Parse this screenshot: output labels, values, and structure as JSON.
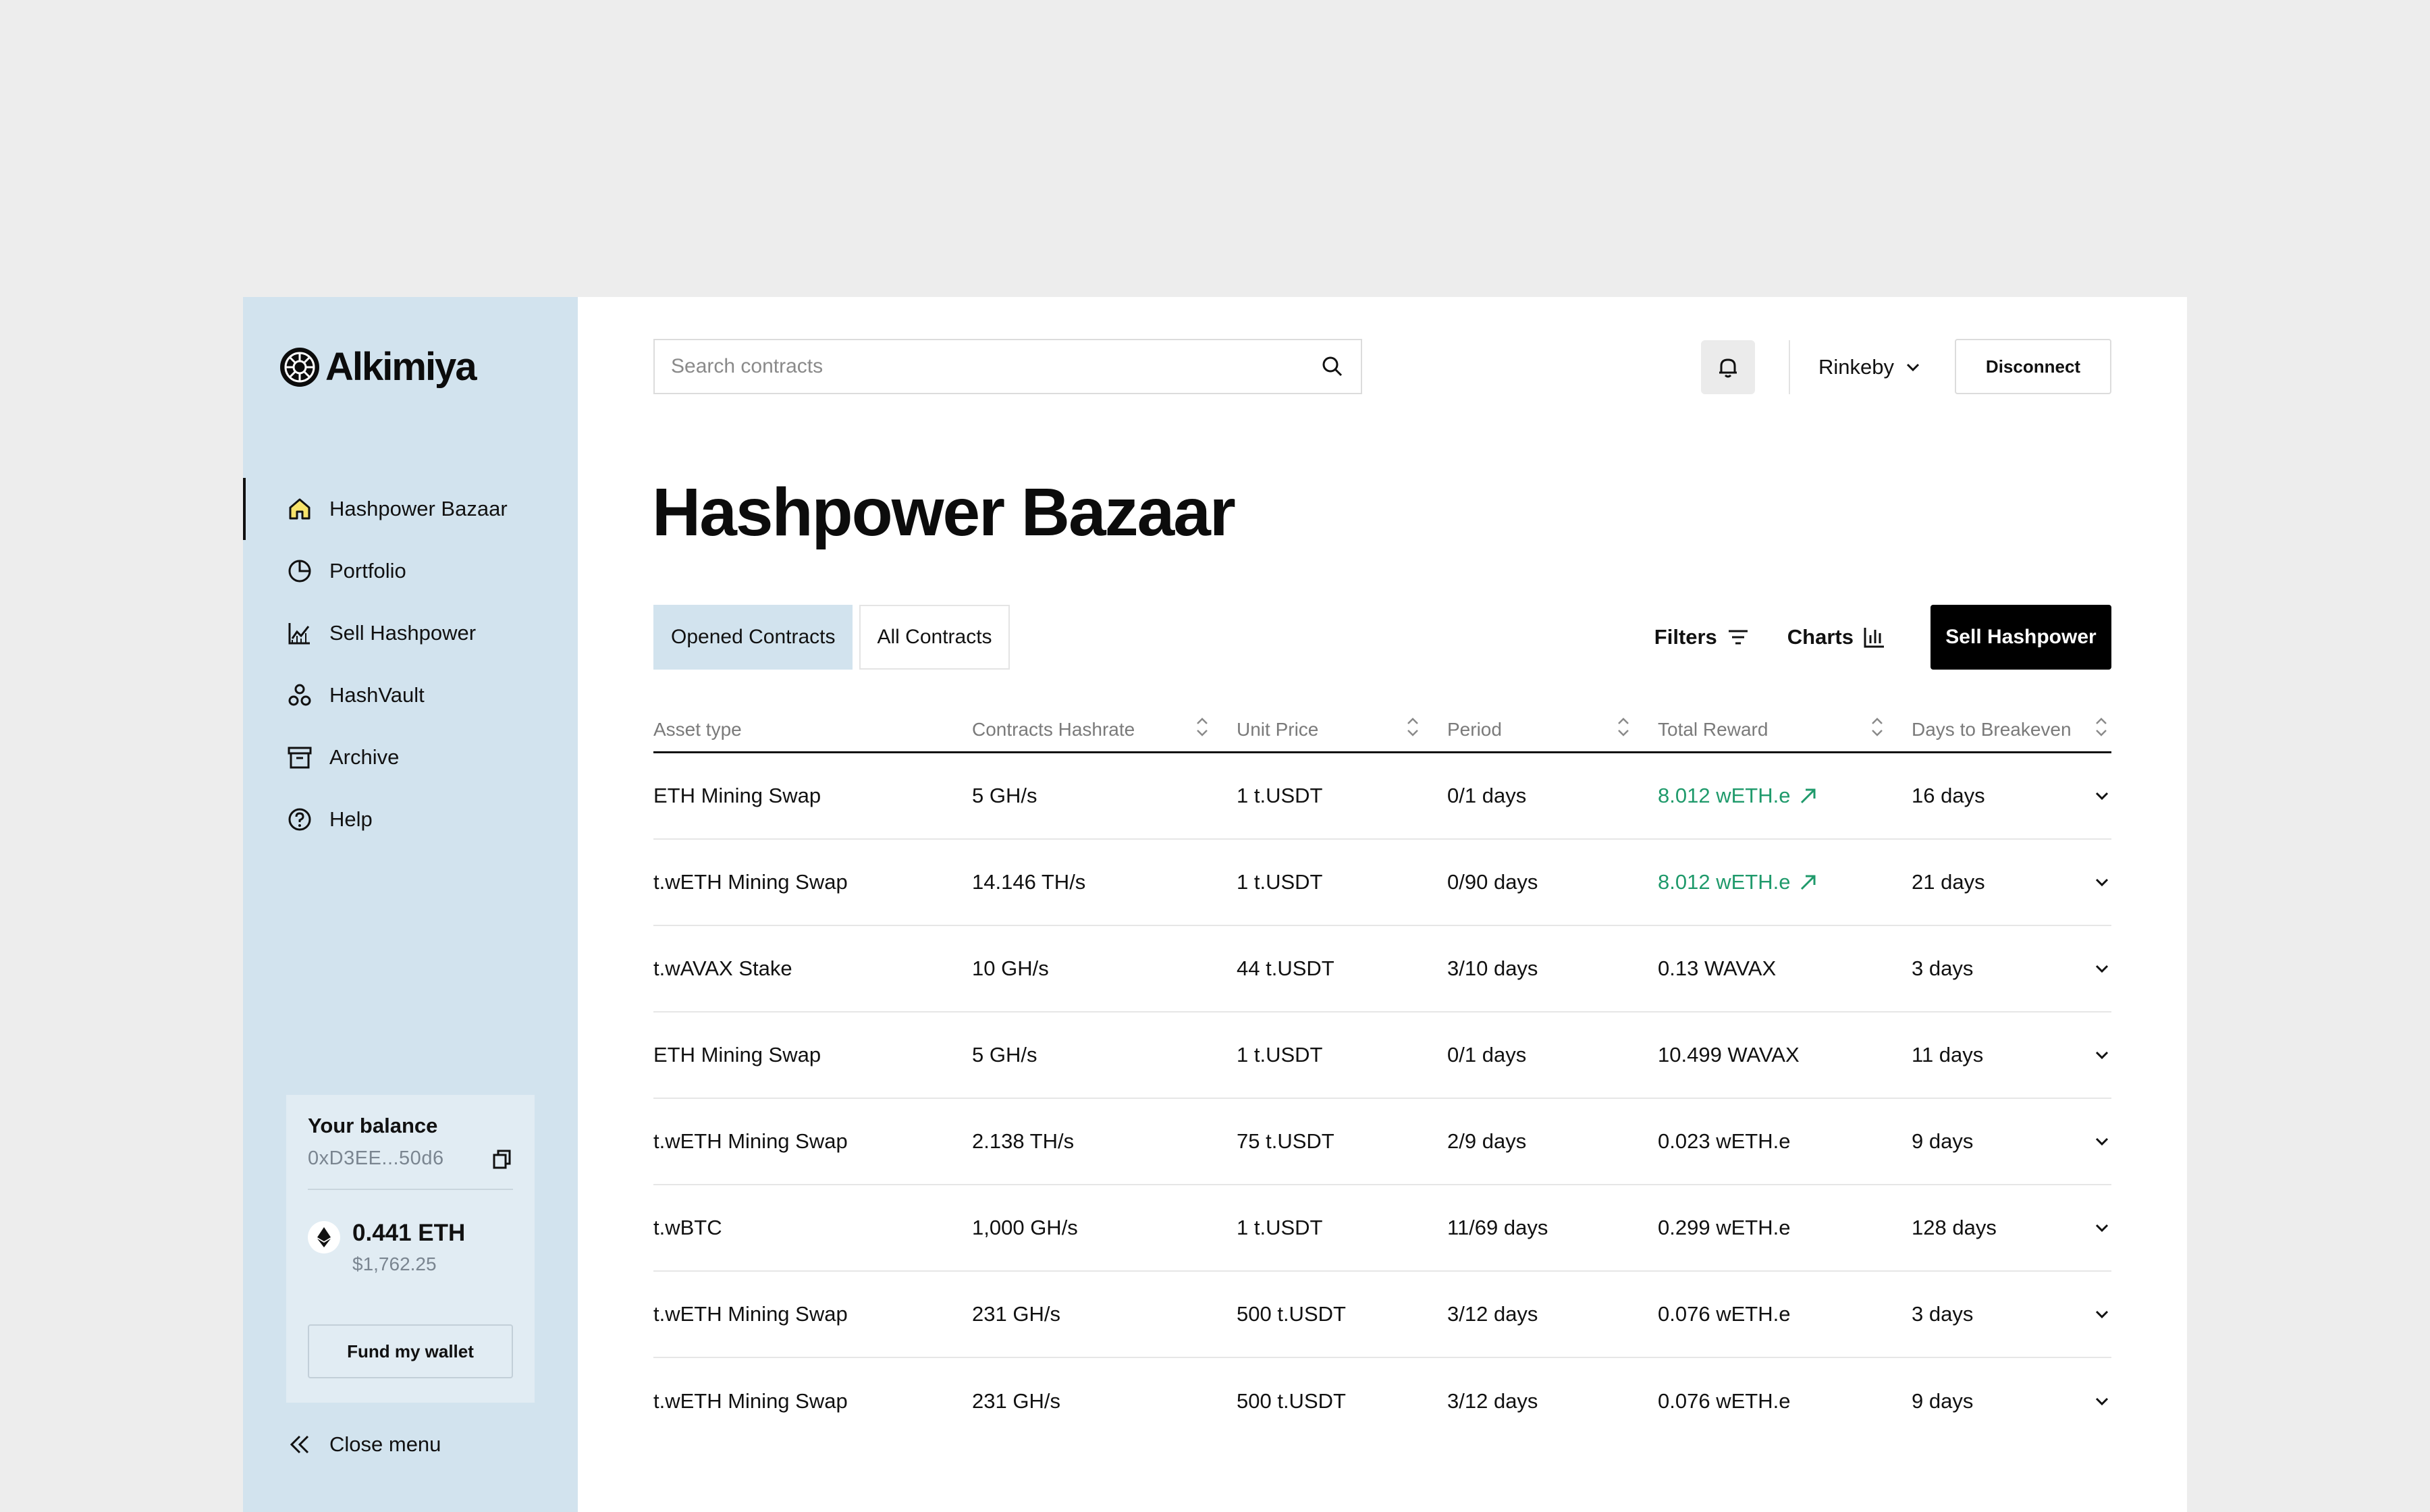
{
  "brand": {
    "name": "Alkimiya"
  },
  "sidebar": {
    "items": [
      {
        "label": "Hashpower Bazaar",
        "icon": "home-icon",
        "active": true
      },
      {
        "label": "Portfolio",
        "icon": "pie-chart-icon",
        "active": false
      },
      {
        "label": "Sell Hashpower",
        "icon": "chart-line-icon",
        "active": false
      },
      {
        "label": "HashVault",
        "icon": "vault-nodes-icon",
        "active": false
      },
      {
        "label": "Archive",
        "icon": "archive-icon",
        "active": false
      },
      {
        "label": "Help",
        "icon": "help-icon",
        "active": false
      }
    ],
    "balance": {
      "title": "Your balance",
      "address": "0xD3EE...50d6",
      "eth": "0.441 ETH",
      "usd": "$1,762.25",
      "fund_label": "Fund my wallet"
    },
    "close_label": "Close menu"
  },
  "header": {
    "search_placeholder": "Search contracts",
    "network": "Rinkeby",
    "disconnect_label": "Disconnect"
  },
  "main": {
    "title": "Hashpower Bazaar",
    "tabs": [
      {
        "label": "Opened Contracts",
        "active": true
      },
      {
        "label": "All Contracts",
        "active": false
      }
    ],
    "filters_label": "Filters",
    "charts_label": "Charts",
    "sell_label": "Sell Hashpower"
  },
  "table": {
    "headers": [
      "Asset type",
      "Contracts Hashrate",
      "Unit Price",
      "Period",
      "Total Reward",
      "Days to Breakeven"
    ],
    "rows": [
      {
        "asset": "ETH Mining Swap",
        "hashrate": "5 GH/s",
        "price": "1 t.USDT",
        "period": "0/1 days",
        "reward": "8.012 wETH.e",
        "trend_up": true,
        "breakeven": "16 days"
      },
      {
        "asset": "t.wETH Mining Swap",
        "hashrate": "14.146 TH/s",
        "price": "1 t.USDT",
        "period": "0/90 days",
        "reward": "8.012 wETH.e",
        "trend_up": true,
        "breakeven": "21 days"
      },
      {
        "asset": "t.wAVAX Stake",
        "hashrate": "10 GH/s",
        "price": "44 t.USDT",
        "period": "3/10 days",
        "reward": "0.13 WAVAX",
        "trend_up": false,
        "breakeven": "3 days"
      },
      {
        "asset": "ETH Mining Swap",
        "hashrate": "5 GH/s",
        "price": "1 t.USDT",
        "period": "0/1 days",
        "reward": "10.499 WAVAX",
        "trend_up": false,
        "breakeven": "11 days"
      },
      {
        "asset": "t.wETH Mining Swap",
        "hashrate": "2.138 TH/s",
        "price": "75 t.USDT",
        "period": "2/9 days",
        "reward": "0.023 wETH.e",
        "trend_up": false,
        "breakeven": "9 days"
      },
      {
        "asset": "t.wBTC",
        "hashrate": "1,000 GH/s",
        "price": "1 t.USDT",
        "period": "11/69 days",
        "reward": "0.299 wETH.e",
        "trend_up": false,
        "breakeven": "128 days"
      },
      {
        "asset": "t.wETH Mining Swap",
        "hashrate": "231 GH/s",
        "price": "500 t.USDT",
        "period": "3/12 days",
        "reward": "0.076 wETH.e",
        "trend_up": false,
        "breakeven": "3 days"
      },
      {
        "asset": "t.wETH Mining Swap",
        "hashrate": "231 GH/s",
        "price": "500 t.USDT",
        "period": "3/12 days",
        "reward": "0.076 wETH.e",
        "trend_up": false,
        "breakeven": "9 days"
      }
    ]
  },
  "colors": {
    "sidebar_bg": "#d2e3ee",
    "reward_up": "#1f9a6b",
    "primary_button": "#000000",
    "home_icon_fill": "#f7e36b"
  }
}
